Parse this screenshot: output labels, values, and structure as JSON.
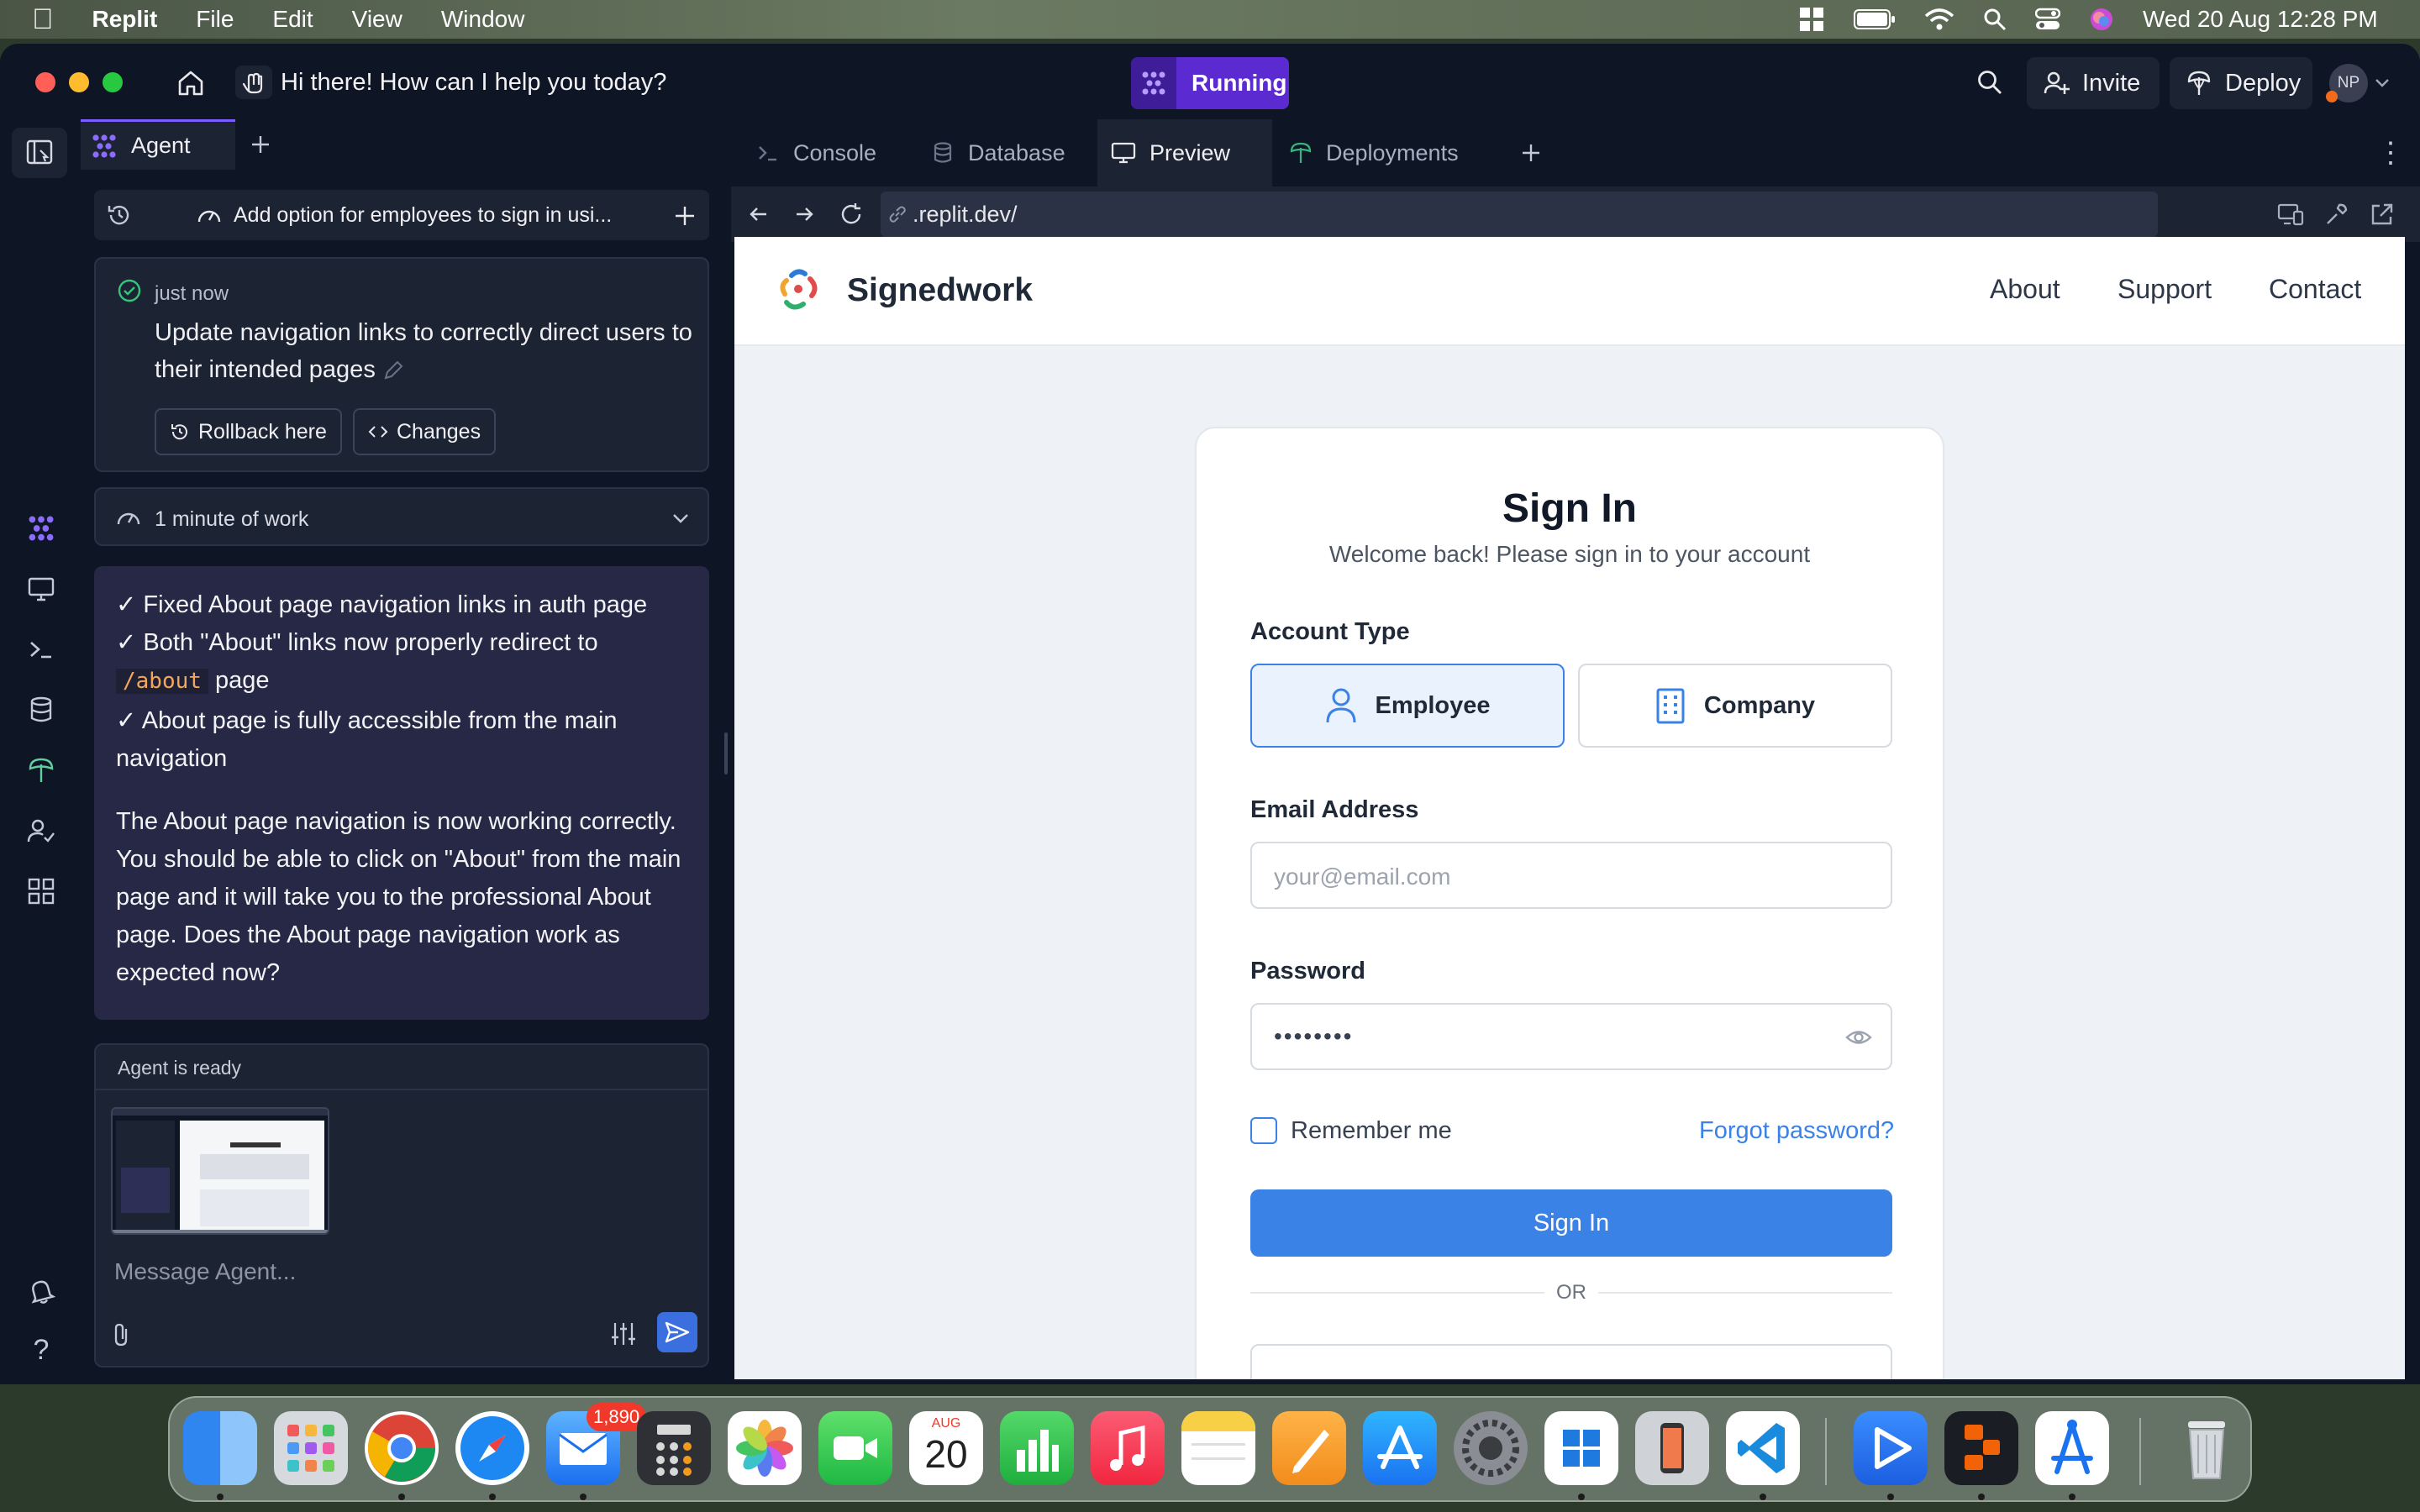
{
  "menubar": {
    "app_name": "Replit",
    "items": [
      "File",
      "Edit",
      "View",
      "Window"
    ],
    "clock": "Wed 20 Aug  12:28 PM"
  },
  "titlebar": {
    "prompt": "Hi there! How can I help you today?",
    "status": "Running",
    "invite": "Invite",
    "deploy": "Deploy",
    "avatar": "NP"
  },
  "agent": {
    "tab_label": "Agent",
    "thread_title": "Add option for employees to sign in usi...",
    "checkpoint": {
      "time": "just now",
      "message": "Update navigation links to correctly direct users to their intended pages",
      "rollback": "Rollback here",
      "changes": "Changes"
    },
    "work_summary": "1 minute of work",
    "response": {
      "check1": "✓ Fixed About page navigation links in auth page",
      "check2a": "✓ Both \"About\" links now properly redirect to",
      "check2_code": "/about",
      "check2b": " page",
      "check3": "✓ About page is fully accessible from the main navigation",
      "paragraph": "The About page navigation is now working correctly. You should be able to click on \"About\" from the main page and it will take you to the professional About page. Does the About page navigation work as expected now?"
    },
    "input": {
      "status": "Agent is ready",
      "placeholder": "Message Agent..."
    }
  },
  "workspace_tabs": [
    "Console",
    "Database",
    "Preview",
    "Deployments"
  ],
  "active_tab": "Preview",
  "url": ".replit.dev/",
  "site": {
    "brand": "Signedwork",
    "nav": [
      "About",
      "Support",
      "Contact"
    ],
    "form": {
      "title": "Sign In",
      "subtitle": "Welcome back! Please sign in to your account",
      "account_type_label": "Account Type",
      "type_employee": "Employee",
      "type_company": "Company",
      "email_label": "Email Address",
      "email_placeholder": "your@email.com",
      "password_label": "Password",
      "password_value": "••••••••",
      "remember": "Remember me",
      "forgot": "Forgot password?",
      "submit": "Sign In",
      "divider": "OR"
    }
  },
  "dock": {
    "mail_badge": "1,890",
    "calendar_month": "AUG",
    "calendar_day": "20"
  },
  "colors": {
    "accent": "#3b82e6",
    "running": "#6d28d9",
    "ide_bg": "#0e1525",
    "panel_bg": "#1c2333"
  }
}
